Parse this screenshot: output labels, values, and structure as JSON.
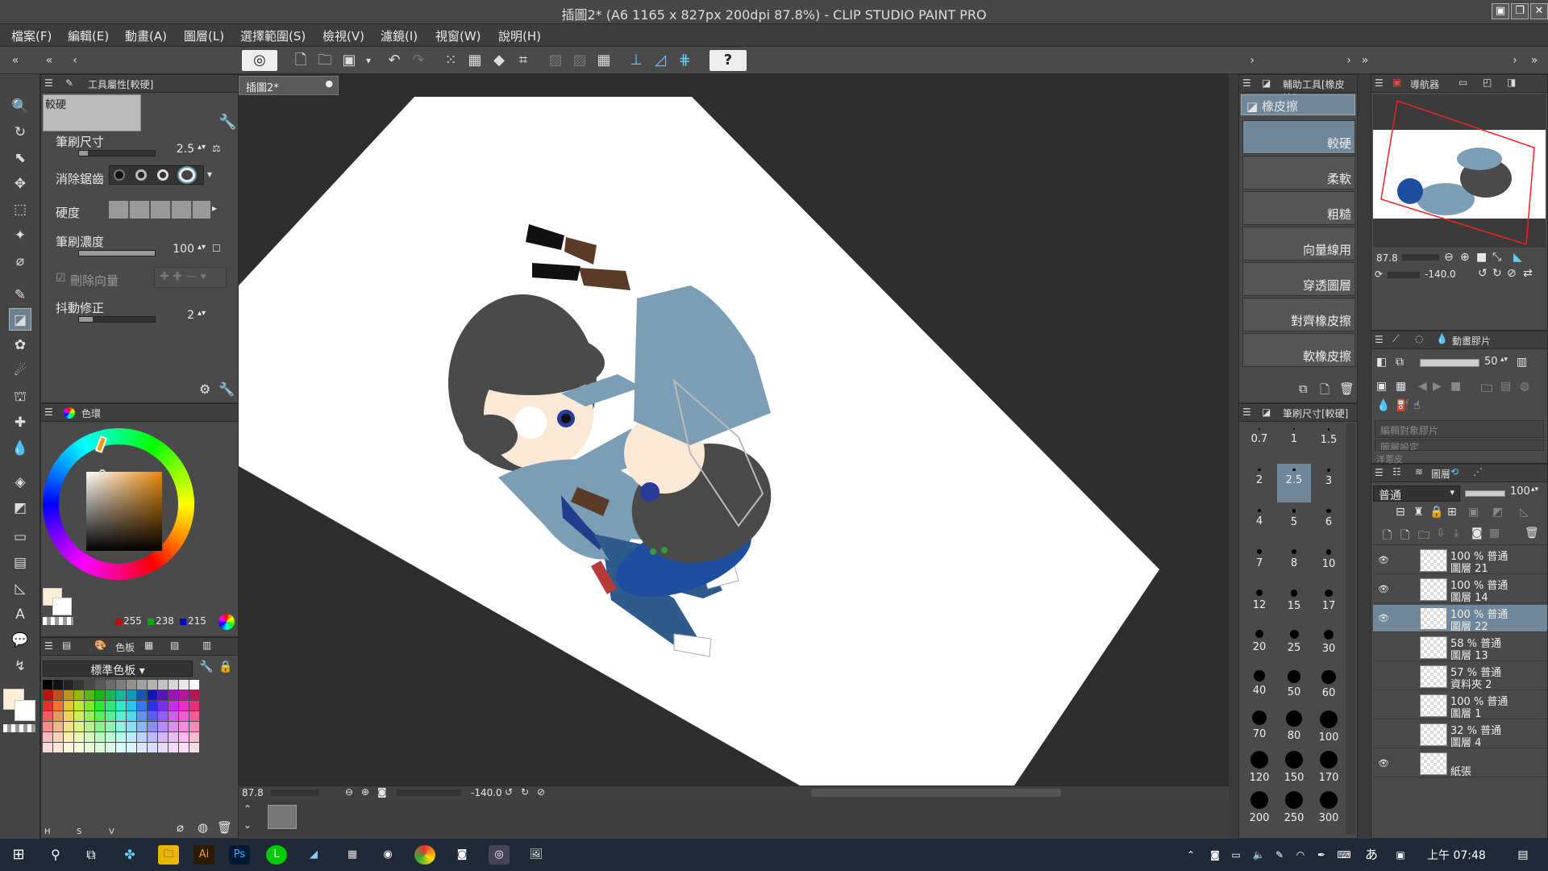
{
  "window": {
    "title": "插圖2* (A6 1165 x 827px 200dpi 87.8%)  - CLIP STUDIO PAINT PRO",
    "controls": [
      "▣",
      "❐",
      "✕"
    ]
  },
  "menu": [
    "檔案(F)",
    "編輯(E)",
    "動畫(A)",
    "圖層(L)",
    "選擇範圍(S)",
    "檢視(V)",
    "濾鏡(I)",
    "視窗(W)",
    "說明(H)"
  ],
  "tool_property": {
    "header": "工具屬性[較硬]",
    "brush_name": "較硬",
    "brush_size_label": "筆刷尺寸",
    "brush_size_value": "2.5",
    "brush_size_level": 0.12,
    "antialias_label": "消除鋸齒",
    "hardness_label": "硬度",
    "density_label": "筆刷濃度",
    "density_value": "100",
    "density_level": 1.0,
    "vector_erase_label": "刪除向量",
    "stabilization_label": "抖動修正",
    "stabilization_value": "2",
    "stabilization_level": 0.18
  },
  "color_wheel": {
    "header": "色環",
    "r": "255",
    "g": "238",
    "b": "215",
    "main_color": "#ffeed7",
    "sub_color": "#ffffff"
  },
  "palette": {
    "header": "色板",
    "set_name": "標準色板",
    "hsv_labels": [
      "H",
      "S",
      "V"
    ]
  },
  "document": {
    "tab_label": "插圖2*",
    "zoom": "87.8",
    "rotation": "-140.0"
  },
  "subtool": {
    "header": "輔助工具[橡皮擦]",
    "group_label": "橡皮擦",
    "items": [
      "較硬",
      "柔軟",
      "粗糙",
      "向量線用",
      "穿透圖層",
      "對齊橡皮擦",
      "軟橡皮擦"
    ]
  },
  "brush_size_panel": {
    "header": "筆刷尺寸[較硬]",
    "sizes": [
      "0.7",
      "1",
      "1.5",
      "2",
      "2.5",
      "3",
      "4",
      "5",
      "6",
      "7",
      "8",
      "10",
      "12",
      "15",
      "17",
      "20",
      "25",
      "30",
      "40",
      "50",
      "60",
      "70",
      "80",
      "100",
      "120",
      "150",
      "170",
      "200",
      "250",
      "300"
    ]
  },
  "navigator": {
    "header": "導航器",
    "zoom": "87.8",
    "rotation": "-140.0"
  },
  "animation": {
    "header": "動畫膠片",
    "value": "50",
    "edit_target": "編輯對象膠片",
    "field2": "圖層設定",
    "onion_label": "洋蔥皮"
  },
  "layers": {
    "header": "圖層",
    "blend_mode": "普通",
    "opacity": "100",
    "items": [
      {
        "line1": "100 % 普通",
        "line2": "圖層 21",
        "visible": true,
        "selected": false
      },
      {
        "line1": "100 % 普通",
        "line2": "圖層 14",
        "visible": true,
        "selected": false
      },
      {
        "line1": "100 % 普通",
        "line2": "圖層 22",
        "visible": true,
        "selected": true
      },
      {
        "line1": "58 % 普通",
        "line2": "圖層 13",
        "visible": false,
        "selected": false
      },
      {
        "line1": "57 % 普通",
        "line2": "資料夾 2",
        "visible": false,
        "selected": false
      },
      {
        "line1": "100 % 普通",
        "line2": "圖層 1",
        "visible": false,
        "selected": false
      },
      {
        "line1": "32 % 普通",
        "line2": "圖層 4",
        "visible": false,
        "selected": false
      },
      {
        "line1": "",
        "line2": "紙張",
        "visible": true,
        "selected": false
      }
    ]
  },
  "taskbar": {
    "time": "上午 07:48",
    "ime": "あ"
  }
}
